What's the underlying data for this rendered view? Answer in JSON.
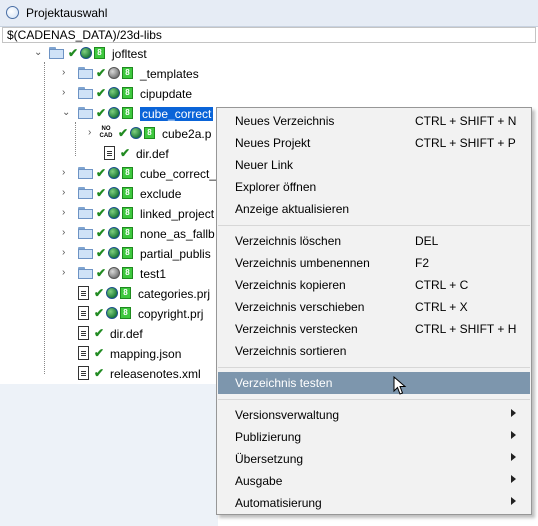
{
  "window": {
    "title": "Projektauswahl",
    "icon": "app-icon"
  },
  "path_field": {
    "value": "$(CADENAS_DATA)/23d-libs"
  },
  "tree": {
    "root": {
      "label": "jofltest",
      "expanded": true
    },
    "items": [
      {
        "label": "_templates",
        "icon": "folder-icon",
        "status": "grey-globe"
      },
      {
        "label": "cipupdate",
        "icon": "folder-icon",
        "status": "green-globe"
      },
      {
        "label": "cube_correct",
        "icon": "folder-icon",
        "status": "green-globe",
        "selected": true,
        "expanded": true
      },
      {
        "label": "cube2a.p",
        "icon": "nocad-icon",
        "status": "green-globe",
        "child": true
      },
      {
        "label": "dir.def",
        "icon": "document-icon",
        "child": true
      },
      {
        "label": "cube_correct_",
        "icon": "folder-icon",
        "status": "green-globe"
      },
      {
        "label": "exclude",
        "icon": "folder-icon",
        "status": "green-globe"
      },
      {
        "label": "linked_project",
        "icon": "folder-icon",
        "status": "green-globe"
      },
      {
        "label": "none_as_fallb",
        "icon": "folder-icon",
        "status": "green-globe"
      },
      {
        "label": "partial_publis",
        "icon": "folder-icon",
        "status": "green-globe"
      },
      {
        "label": "test1",
        "icon": "folder-icon",
        "status": "grey-globe"
      },
      {
        "label": "categories.prj",
        "icon": "document-icon",
        "status": "green-globe"
      },
      {
        "label": "copyright.prj",
        "icon": "document-icon",
        "status": "green-globe"
      },
      {
        "label": "dir.def",
        "icon": "document-icon"
      },
      {
        "label": "mapping.json",
        "icon": "document-icon"
      },
      {
        "label": "releasenotes.xml",
        "icon": "document-icon"
      }
    ]
  },
  "context_menu": {
    "groups": [
      [
        {
          "label": "Neues Verzeichnis",
          "shortcut": "CTRL + SHIFT + N"
        },
        {
          "label": "Neues Projekt",
          "shortcut": "CTRL + SHIFT + P"
        },
        {
          "label": "Neuer Link",
          "shortcut": ""
        },
        {
          "label": "Explorer öffnen",
          "shortcut": ""
        },
        {
          "label": "Anzeige aktualisieren",
          "shortcut": ""
        }
      ],
      [
        {
          "label": "Verzeichnis löschen",
          "shortcut": "DEL"
        },
        {
          "label": "Verzeichnis umbenennen",
          "shortcut": "F2"
        },
        {
          "label": "Verzeichnis kopieren",
          "shortcut": "CTRL + C"
        },
        {
          "label": "Verzeichnis verschieben",
          "shortcut": "CTRL + X"
        },
        {
          "label": "Verzeichnis verstecken",
          "shortcut": "CTRL + SHIFT + H"
        },
        {
          "label": "Verzeichnis sortieren",
          "shortcut": ""
        }
      ],
      [
        {
          "label": "Verzeichnis testen",
          "shortcut": "",
          "highlighted": true
        }
      ],
      [
        {
          "label": "Versionsverwaltung",
          "submenu": true
        },
        {
          "label": "Publizierung",
          "submenu": true
        },
        {
          "label": "Übersetzung",
          "submenu": true
        },
        {
          "label": "Ausgabe",
          "submenu": true
        },
        {
          "label": "Automatisierung",
          "submenu": true
        }
      ]
    ]
  },
  "colors": {
    "selection": "#0a64d8",
    "menu_highlight": "#7d96ad",
    "menu_background": "#f2f2f2",
    "status_green": "#3ec83e"
  }
}
